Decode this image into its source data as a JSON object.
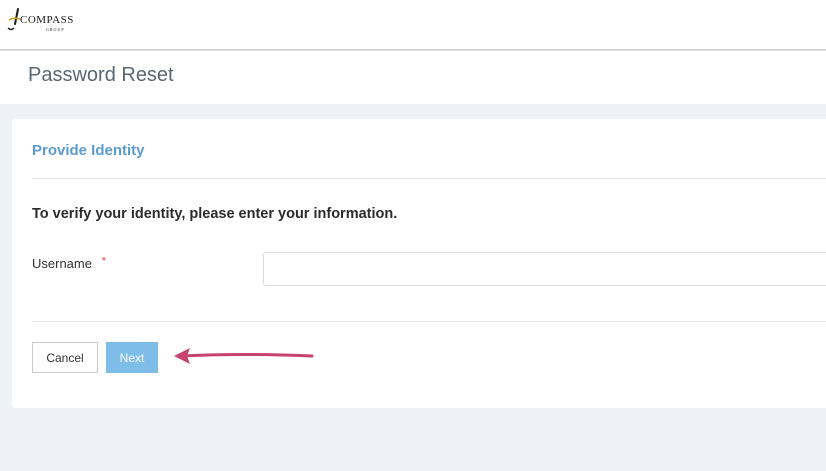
{
  "logo": {
    "brand": "COMPASS",
    "subbrand": "GROUP"
  },
  "page": {
    "title": "Password Reset"
  },
  "form": {
    "section_title": "Provide Identity",
    "instruction": "To verify your identity, please enter your information.",
    "username_label": "Username",
    "required_mark": "*",
    "username_value": "",
    "username_placeholder": ""
  },
  "buttons": {
    "cancel": "Cancel",
    "next": "Next"
  },
  "colors": {
    "accent": "#5b9bd1",
    "next_button": "#7fbde9",
    "required": "#e02020",
    "annotation_arrow": "#c8446e"
  },
  "annotation": {
    "icon": "arrow-left-icon"
  }
}
